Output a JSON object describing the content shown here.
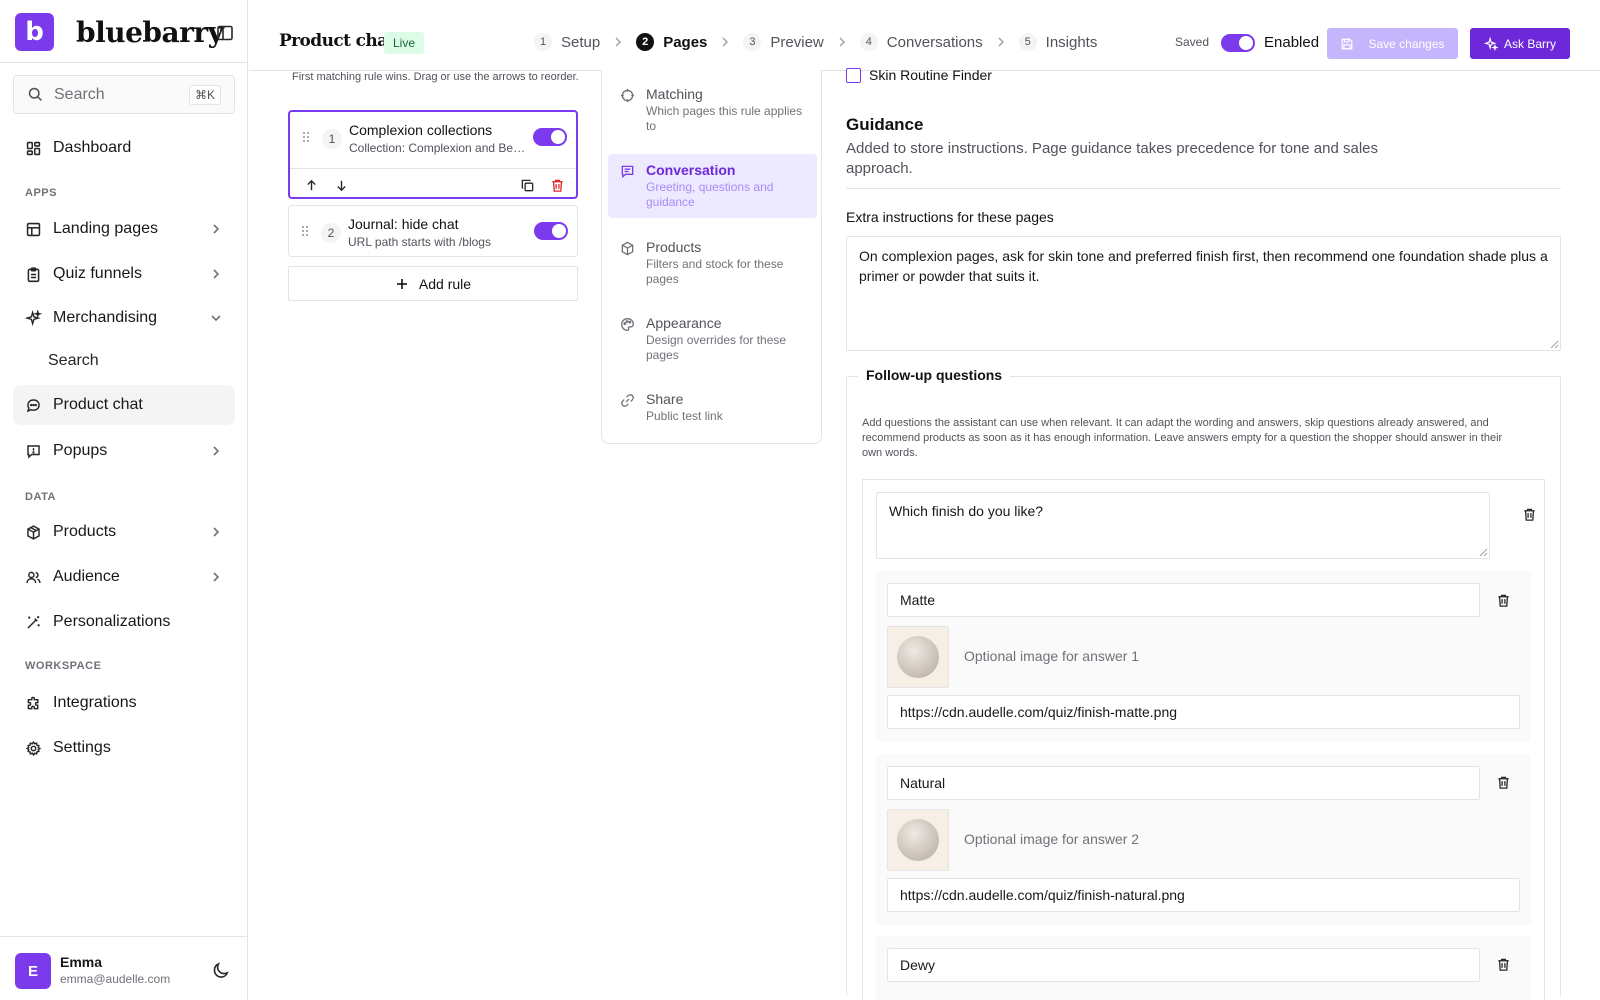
{
  "brand": {
    "logo_letter": "b",
    "name": "bluebarry"
  },
  "sidebar": {
    "search_placeholder": "Search",
    "search_shortcut": "⌘K",
    "dashboard": "Dashboard",
    "sections": {
      "apps": "APPS",
      "data": "DATA",
      "workspace": "WORKSPACE"
    },
    "items": {
      "landing_pages": "Landing pages",
      "quiz_funnels": "Quiz funnels",
      "merchandising": "Merchandising",
      "merch_search": "Search",
      "product_chat": "Product chat",
      "popups": "Popups",
      "products": "Products",
      "audience": "Audience",
      "personalizations": "Personalizations",
      "integrations": "Integrations",
      "settings": "Settings"
    },
    "active": "product_chat"
  },
  "user": {
    "initial": "E",
    "name": "Emma",
    "email": "emma@audelle.com"
  },
  "header": {
    "title": "Product chat",
    "status_badge": "Live",
    "steps": [
      {
        "num": "1",
        "label": "Setup"
      },
      {
        "num": "2",
        "label": "Pages"
      },
      {
        "num": "3",
        "label": "Preview"
      },
      {
        "num": "4",
        "label": "Conversations"
      },
      {
        "num": "5",
        "label": "Insights"
      }
    ],
    "active_step": 2,
    "saved_label": "Saved",
    "enabled_label": "Enabled",
    "enabled": true,
    "save_button": "Save changes",
    "ask_button": "Ask Barry"
  },
  "rules": {
    "hint": "First matching rule wins. Drag or use the arrows to reorder.",
    "items": [
      {
        "num": "1",
        "title": "Complexion collections",
        "subtitle": "Collection: Complexion and Beauty",
        "enabled": true,
        "selected": true
      },
      {
        "num": "2",
        "title": "Journal: hide chat",
        "subtitle": "URL path starts with /blogs",
        "enabled": true,
        "selected": false
      }
    ],
    "add_label": "Add rule"
  },
  "section_nav": [
    {
      "title": "Matching",
      "desc": "Which pages this rule applies to",
      "icon": "target-icon"
    },
    {
      "title": "Conversation",
      "desc": "Greeting, questions and guidance",
      "icon": "chat-icon",
      "active": true
    },
    {
      "title": "Products",
      "desc": "Filters and stock for these pages",
      "icon": "box-icon"
    },
    {
      "title": "Appearance",
      "desc": "Design overrides for these pages",
      "icon": "palette-icon"
    },
    {
      "title": "Share",
      "desc": "Public test link",
      "icon": "link-icon"
    }
  ],
  "content": {
    "checkbox_label": "Skin Routine Finder",
    "guidance_title": "Guidance",
    "guidance_desc": "Added to store instructions. Page guidance takes precedence for tone and sales approach.",
    "extra_label": "Extra instructions for these pages",
    "extra_value": "On complexion pages, ask for skin tone and preferred finish first, then recommend one foundation shade plus a primer or powder that suits it.",
    "followup_legend": "Follow-up questions",
    "followup_desc": "Add questions the assistant can use when relevant. It can adapt the wording and answers, skip questions already answered, and recommend products as soon as it has enough information. Leave answers empty for a question the shopper should answer in their own words.",
    "question": "Which finish do you like?",
    "answers": [
      {
        "label": "Matte",
        "image_label": "Optional image for answer 1",
        "url": "https://cdn.audelle.com/quiz/finish-matte.png"
      },
      {
        "label": "Natural",
        "image_label": "Optional image for answer 2",
        "url": "https://cdn.audelle.com/quiz/finish-natural.png"
      },
      {
        "label": "Dewy"
      }
    ]
  }
}
